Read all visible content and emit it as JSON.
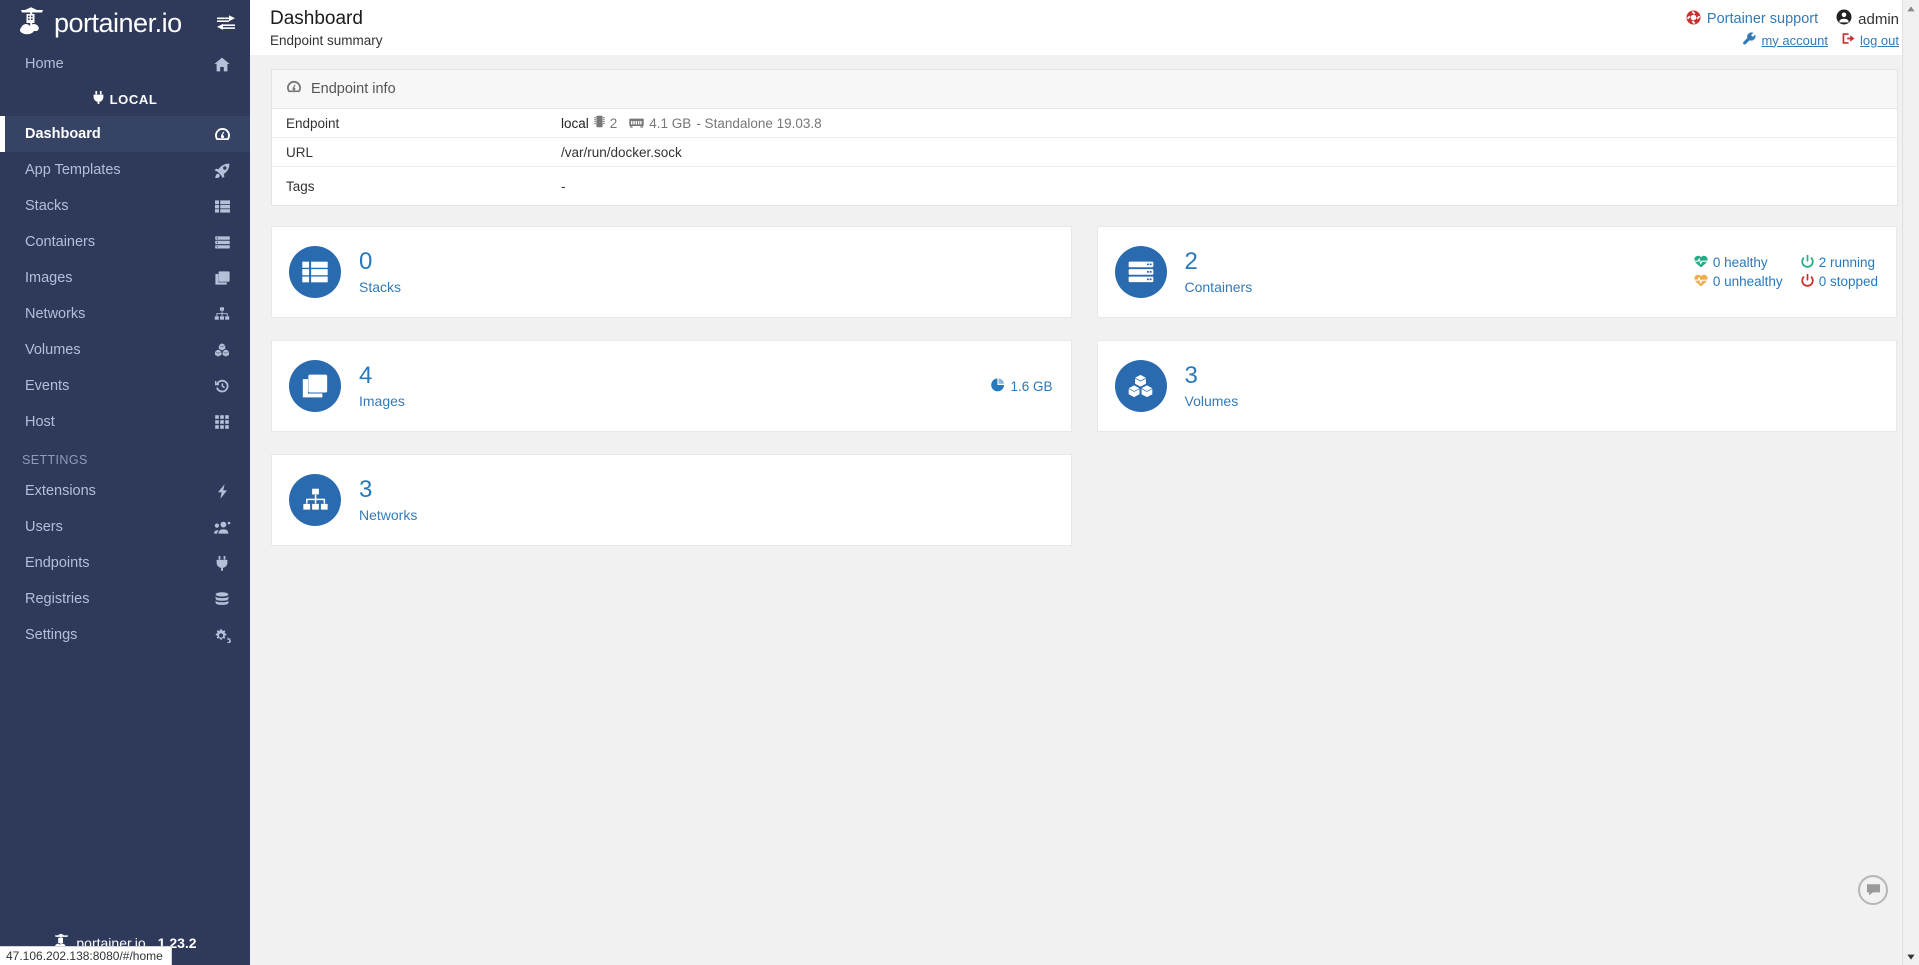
{
  "brand": {
    "logo_text": "portainer.io",
    "logo_icon": "portainer-crane-logo-icon",
    "toggle_icon": "collapse-sidebar-icon",
    "version": "1.23.2",
    "footer_text": "portainer.io"
  },
  "sidebar": {
    "home": {
      "label": "Home",
      "icon": "home-icon"
    },
    "endpoint_title": {
      "label": "LOCAL",
      "icon": "plug-icon"
    },
    "items": [
      {
        "label": "Dashboard",
        "icon": "tachometer-icon",
        "active": true
      },
      {
        "label": "App Templates",
        "icon": "rocket-icon",
        "active": false
      },
      {
        "label": "Stacks",
        "icon": "list-icon",
        "active": false
      },
      {
        "label": "Containers",
        "icon": "server-icon",
        "active": false
      },
      {
        "label": "Images",
        "icon": "clone-icon",
        "active": false
      },
      {
        "label": "Networks",
        "icon": "sitemap-icon",
        "active": false
      },
      {
        "label": "Volumes",
        "icon": "cubes-icon",
        "active": false
      },
      {
        "label": "Events",
        "icon": "history-icon",
        "active": false
      },
      {
        "label": "Host",
        "icon": "th-icon",
        "active": false
      }
    ],
    "settings_section": "SETTINGS",
    "settings_items": [
      {
        "label": "Extensions",
        "icon": "bolt-icon"
      },
      {
        "label": "Users",
        "icon": "users-icon"
      },
      {
        "label": "Endpoints",
        "icon": "plug-icon"
      },
      {
        "label": "Registries",
        "icon": "database-icon"
      },
      {
        "label": "Settings",
        "icon": "cogs-icon"
      }
    ]
  },
  "header": {
    "title": "Dashboard",
    "subtitle": "Endpoint summary",
    "support_label": "Portainer support",
    "support_icon": "lifebuoy-icon",
    "user_name": "admin",
    "user_icon": "user-circle-icon",
    "my_account_label": "my account",
    "my_account_icon": "wrench-icon",
    "logout_label": "log out",
    "logout_icon": "sign-out-icon"
  },
  "endpoint_info": {
    "panel_title": "Endpoint info",
    "panel_icon": "tachometer-icon",
    "rows": [
      {
        "key": "Endpoint",
        "value": ""
      },
      {
        "key": "URL",
        "value": "/var/run/docker.sock"
      },
      {
        "key": "Tags",
        "value": "-"
      }
    ],
    "endpoint_name": "local",
    "cpu_icon": "microchip-icon",
    "cpu_count": "2",
    "memory_icon": "memory-icon",
    "memory_total": "4.1 GB",
    "engine": "- Standalone 19.03.8"
  },
  "cards": {
    "stacks": {
      "count": "0",
      "label": "Stacks",
      "icon": "stacks-icon"
    },
    "containers": {
      "count": "2",
      "label": "Containers",
      "icon": "containers-icon"
    },
    "images": {
      "count": "4",
      "label": "Images",
      "icon": "images-icon",
      "size": "1.6 GB",
      "size_icon": "pie-chart-icon"
    },
    "volumes": {
      "count": "3",
      "label": "Volumes",
      "icon": "volumes-icon"
    },
    "networks": {
      "count": "3",
      "label": "Networks",
      "icon": "networks-icon"
    },
    "container_status": [
      {
        "label": "0 healthy",
        "icon": "heartbeat-icon",
        "color": "#23ae89"
      },
      {
        "label": "2 running",
        "icon": "power-icon",
        "color": "#23ae89"
      },
      {
        "label": "0 unhealthy",
        "icon": "heartbeat-icon",
        "color": "#f0ad4e"
      },
      {
        "label": "0 stopped",
        "icon": "power-icon",
        "color": "#c9302c"
      }
    ]
  },
  "chat_widget": {
    "icon": "chat-bubble-icon"
  },
  "status_bar": {
    "url": "47.106.202.138:8080/#/home"
  },
  "colors": {
    "sidebar_bg": "#2f3a5a",
    "accent_blue": "#2a6bb0",
    "link_blue": "#337ab7",
    "healthy_green": "#23ae89",
    "unhealthy_orange": "#f0ad4e",
    "stopped_red": "#c9302c"
  }
}
